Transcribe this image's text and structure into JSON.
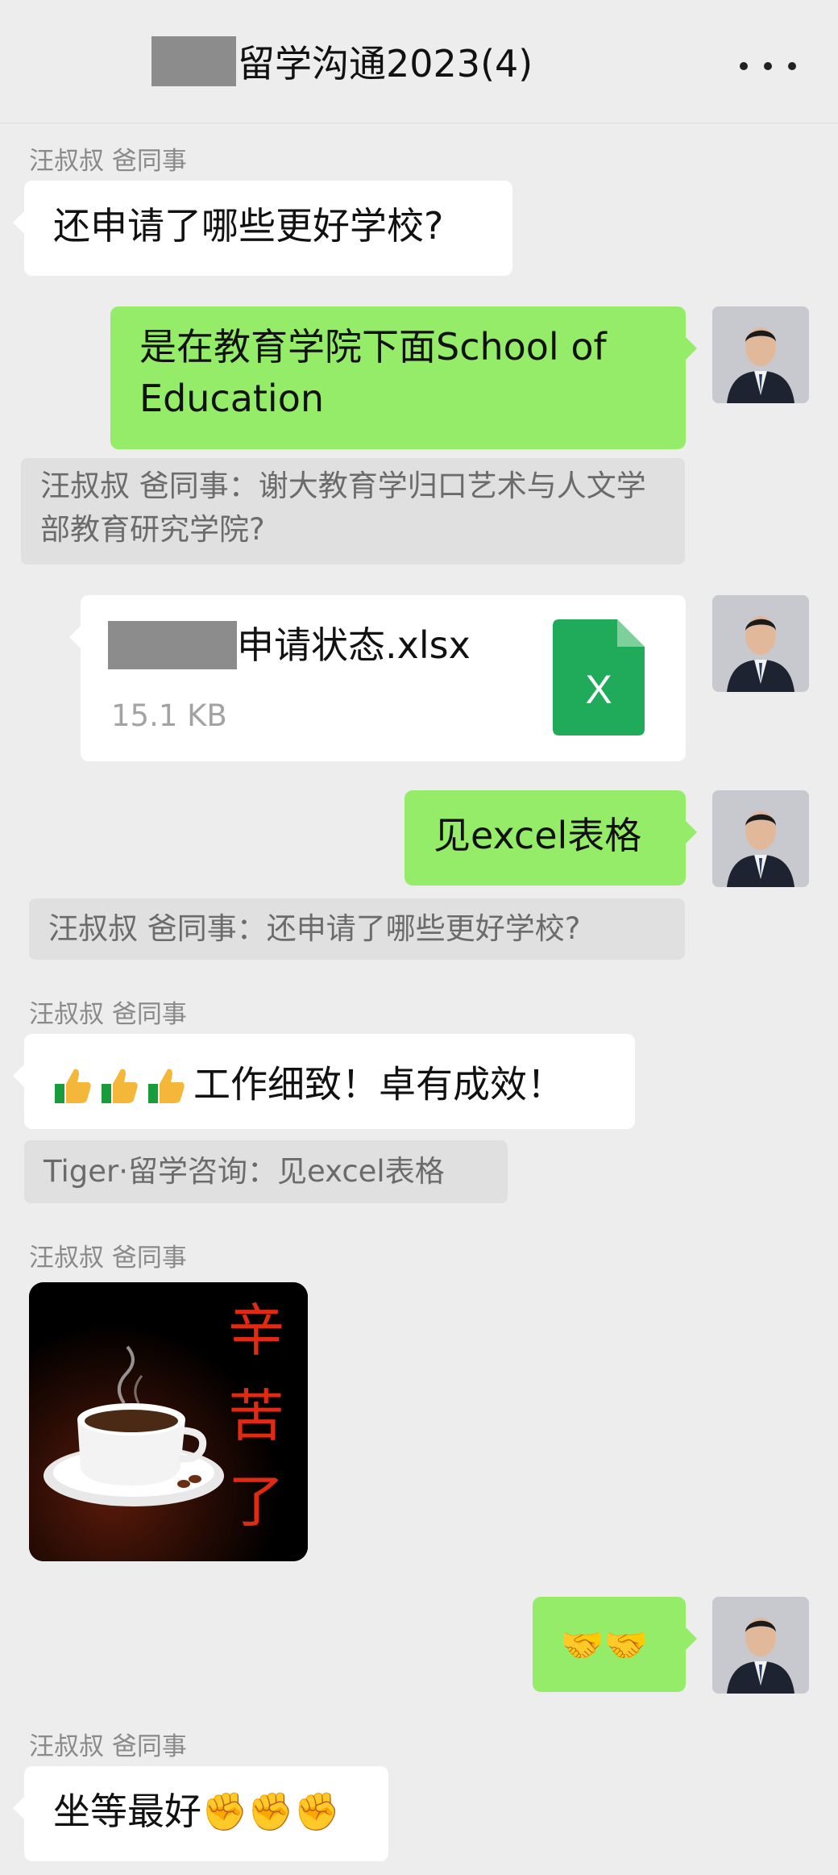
{
  "header": {
    "title": "留学沟通2023(4)",
    "more_label": "···"
  },
  "messages": {
    "m1_sender": "汪叔叔 爸同事",
    "m1_text": "还申请了哪些更好学校?",
    "m2_text": "是在教育学院下面School of Education",
    "m2_quote": "汪叔叔 爸同事：谢大教育学归口艺术与人文学部教育研究学院?",
    "file_name": "申请状态.xlsx",
    "file_size": "15.1 KB",
    "file_icon_letter": "X",
    "m4_text": "见excel表格",
    "m4_quote": "汪叔叔 爸同事：还申请了哪些更好学校?",
    "m5_sender": "汪叔叔 爸同事",
    "m5_text": "工作细致！卓有成效！",
    "m5_quote": "Tiger·留学咨询：见excel表格",
    "m6_sender": "汪叔叔 爸同事",
    "sticker_text": "辛苦了",
    "m7_text": "🤝🤝",
    "m8_sender": "汪叔叔 爸同事",
    "m8_text": "坐等最好✊✊✊"
  },
  "colors": {
    "background": "#ededed",
    "outgoing_bubble": "#95ec69",
    "incoming_bubble": "#ffffff",
    "excel_green": "#1fab5a"
  },
  "icons": [
    "more-icon",
    "excel-file-icon",
    "thumbs-up-icon",
    "handshake-icon",
    "fist-icon"
  ]
}
